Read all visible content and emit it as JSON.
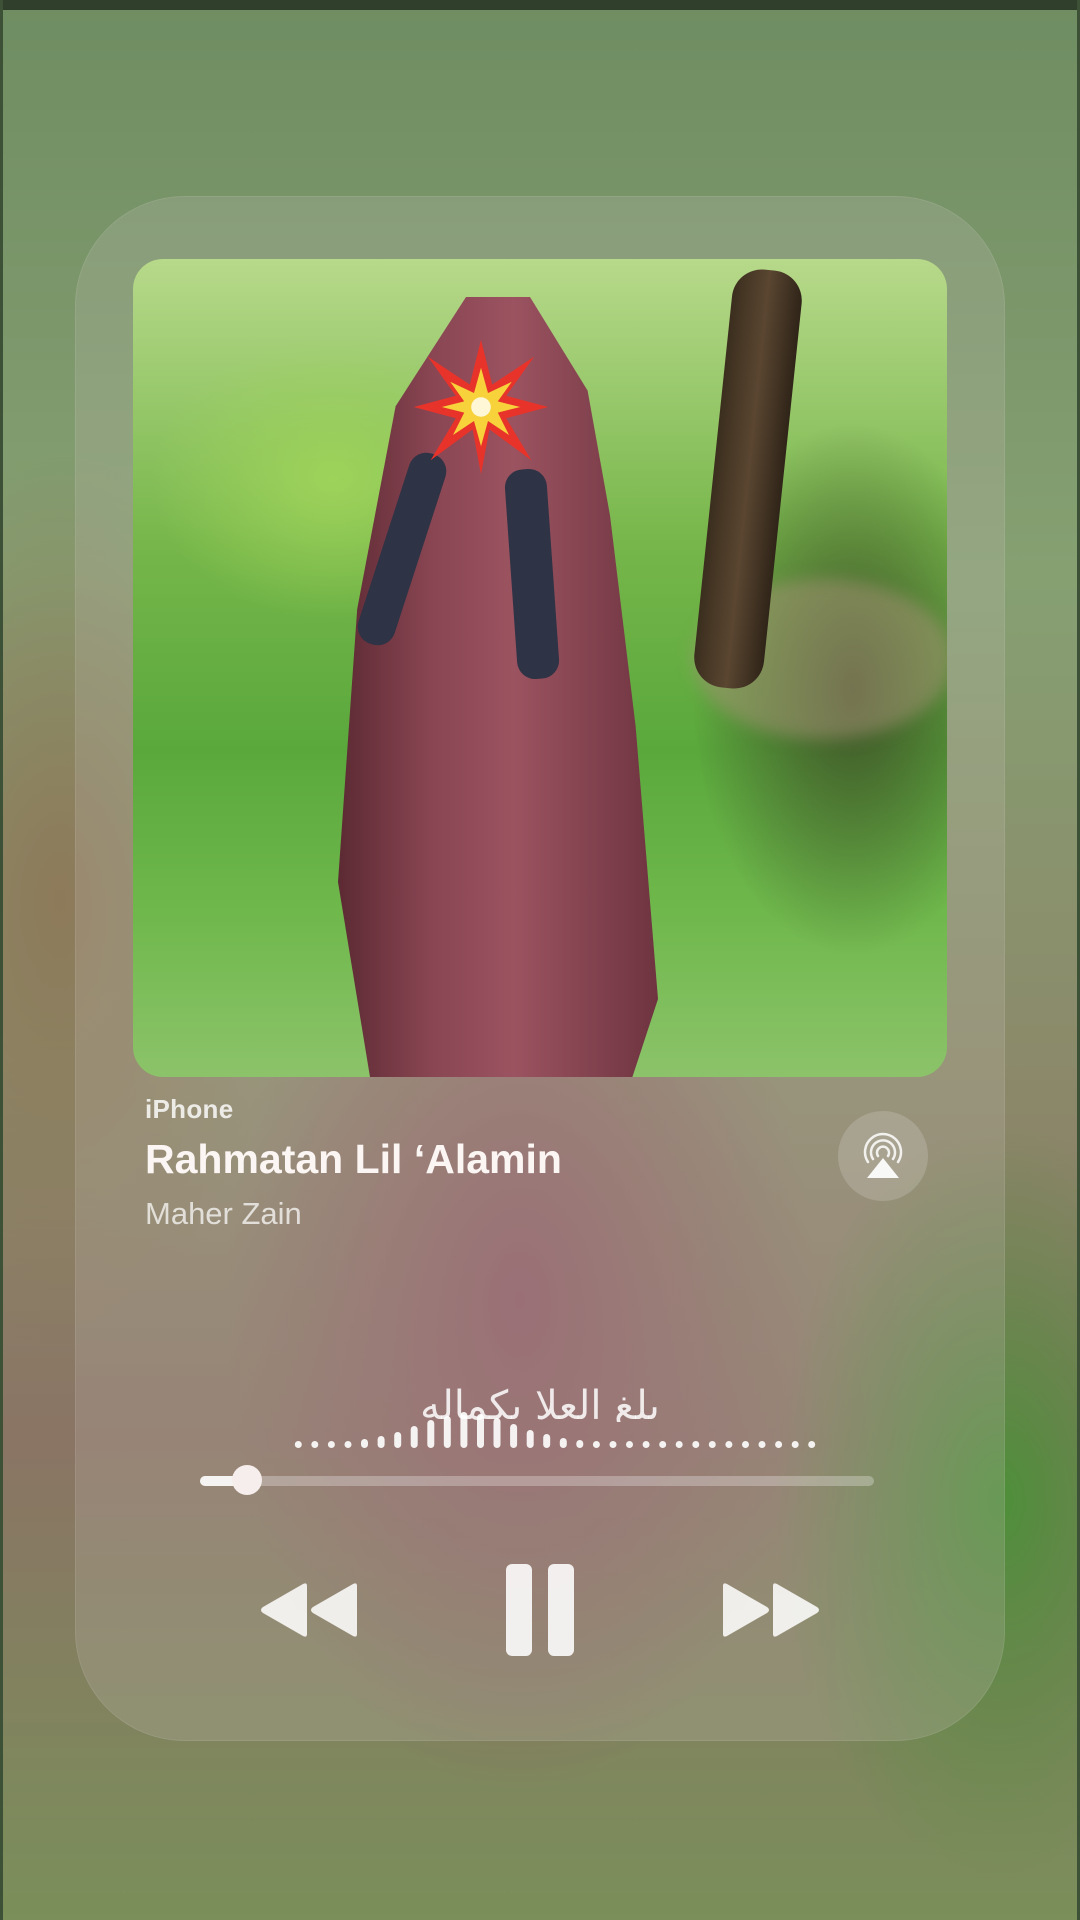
{
  "now_playing": {
    "source": "iPhone",
    "title": "Rahmatan Lil ‘Alamin",
    "artist": "Maher Zain",
    "lyric": "بلغ العلا بكماله"
  },
  "playback": {
    "progress": 0.07,
    "state": "playing"
  },
  "icons": {
    "airplay": "airplay-icon",
    "rewind": "rewind-icon",
    "pause": "pause-icon",
    "forward": "fast-forward-icon"
  },
  "colors": {
    "text_primary": "#fbf6f4",
    "accent_artwork_robe": "#8a4653"
  }
}
